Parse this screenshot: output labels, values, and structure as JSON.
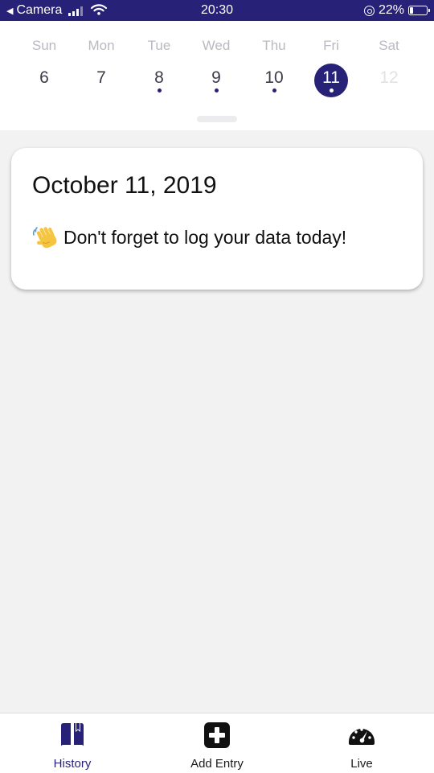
{
  "status_bar": {
    "back_label": "Camera",
    "time": "20:30",
    "battery_text": "22%",
    "battery_level": 0.22
  },
  "week": {
    "days": [
      {
        "name": "Sun",
        "num": "6",
        "has_entry": false,
        "selected": false,
        "future": false
      },
      {
        "name": "Mon",
        "num": "7",
        "has_entry": false,
        "selected": false,
        "future": false
      },
      {
        "name": "Tue",
        "num": "8",
        "has_entry": true,
        "selected": false,
        "future": false
      },
      {
        "name": "Wed",
        "num": "9",
        "has_entry": true,
        "selected": false,
        "future": false
      },
      {
        "name": "Thu",
        "num": "10",
        "has_entry": true,
        "selected": false,
        "future": false
      },
      {
        "name": "Fri",
        "num": "11",
        "has_entry": true,
        "selected": true,
        "future": false
      },
      {
        "name": "Sat",
        "num": "12",
        "has_entry": false,
        "selected": false,
        "future": true
      }
    ]
  },
  "card": {
    "date": "October 11, 2019",
    "message": "Don't forget to log your data today!",
    "emoji_icon": "waving-hand-icon"
  },
  "tabs": [
    {
      "label": "History",
      "icon": "book-icon",
      "active": true
    },
    {
      "label": "Add Entry",
      "icon": "plus-square-icon",
      "active": false
    },
    {
      "label": "Live",
      "icon": "speedometer-icon",
      "active": false
    }
  ],
  "colors": {
    "accent": "#272177",
    "background": "#f2f2f2"
  }
}
